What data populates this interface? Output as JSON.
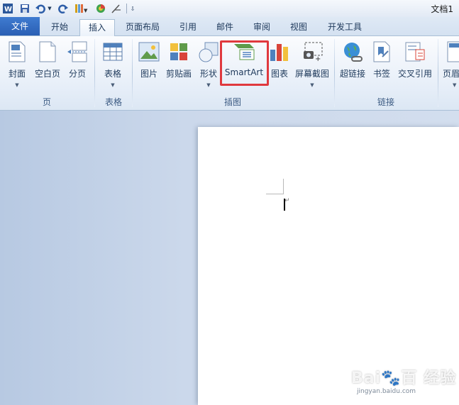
{
  "window": {
    "doc_title": "文档1"
  },
  "qat": {
    "icons": [
      "word-logo-icon",
      "save-icon",
      "undo-icon",
      "dropdown-arrow-icon",
      "redo-icon",
      "format-painter-icon",
      "color-icon",
      "clear-format-icon",
      "customize-qat-icon"
    ]
  },
  "tabs": [
    {
      "label": "文件"
    },
    {
      "label": "开始"
    },
    {
      "label": "插入"
    },
    {
      "label": "页面布局"
    },
    {
      "label": "引用"
    },
    {
      "label": "邮件"
    },
    {
      "label": "审阅"
    },
    {
      "label": "视图"
    },
    {
      "label": "开发工具"
    }
  ],
  "ribbon": {
    "groups": {
      "page": "页",
      "table": "表格",
      "illustration": "插图",
      "links": "链接"
    },
    "buttons": {
      "cover": "封面",
      "blank_page": "空白页",
      "page_break": "分页",
      "table": "表格",
      "picture": "图片",
      "clip_art": "剪贴画",
      "shapes": "形状",
      "smartart": "SmartArt",
      "chart": "图表",
      "screenshot": "屏幕截图",
      "hyperlink": "超链接",
      "bookmark": "书签",
      "cross_ref": "交叉引用",
      "header_partial": "页眉"
    }
  },
  "document": {
    "paragraph_mark": "↵"
  },
  "watermark": {
    "brand": "Bai🐾百 经验",
    "url": "jingyan.baidu.com"
  },
  "colors": {
    "file_tab": "#2a5fb4",
    "highlight_box": "#e0393e"
  }
}
